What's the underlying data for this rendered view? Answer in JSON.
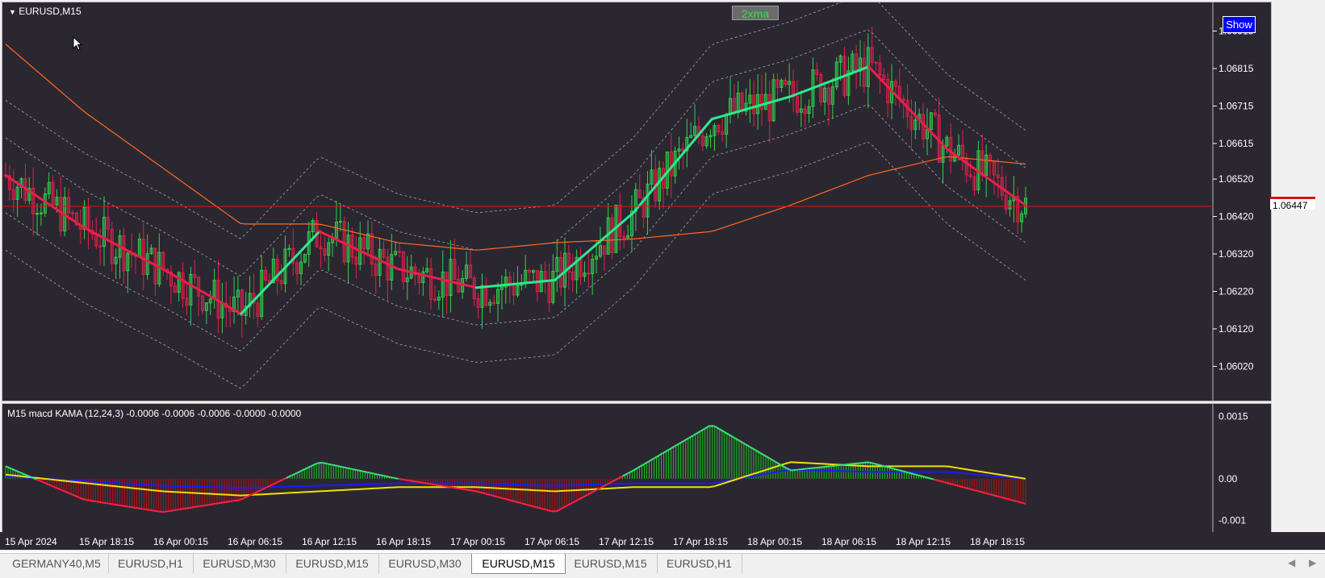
{
  "chart": {
    "symbol_title": "EURUSD,M15",
    "price_axis_labels": [
      "1.06915",
      "1.06815",
      "1.06715",
      "1.06615",
      "1.06520",
      "1.06420",
      "1.06320",
      "1.06220",
      "1.06120",
      "1.06020"
    ],
    "current_price": "1.06447",
    "buttons": {
      "xma_label": "2xma",
      "show_label": "Show"
    },
    "colors": {
      "background": "#2b2731",
      "bull_candle": "#2fd14b",
      "bear_candle": "#e0204a",
      "kama_up": "#2ee88f",
      "kama_down": "#e8204a",
      "long_ma": "#ff6a20",
      "price_line": "#e01010"
    }
  },
  "indicator": {
    "title": "M15  macd KAMA (12,24,3)  -0.0006 -0.0006 -0.0006 -0.0000 -0.0000",
    "axis_labels": [
      "0.0015",
      "0.00",
      "-0.001"
    ],
    "colors": {
      "hist_pos": "#19c21f",
      "hist_neg": "#b31111",
      "signal": "#f2e000",
      "base": "#1a1aff"
    }
  },
  "time_axis": [
    "15 Apr 2024",
    "15 Apr 18:15",
    "16 Apr 00:15",
    "16 Apr 06:15",
    "16 Apr 12:15",
    "16 Apr 18:15",
    "17 Apr 00:15",
    "17 Apr 06:15",
    "17 Apr 12:15",
    "17 Apr 18:15",
    "18 Apr 00:15",
    "18 Apr 06:15",
    "18 Apr 12:15",
    "18 Apr 18:15"
  ],
  "tabs": [
    "GERMANY40,M5",
    "EURUSD,H1",
    "EURUSD,M30",
    "EURUSD,M15",
    "EURUSD,M30",
    "EURUSD,M15",
    "EURUSD,M15",
    "EURUSD,H1"
  ],
  "active_tab_index": 5,
  "chart_data": {
    "type": "line",
    "title": "EURUSD,M15",
    "xlabel": "",
    "ylabel": "",
    "ylim": [
      1.0598,
      1.0697
    ],
    "x": [
      "15 Apr 2024",
      "15 Apr 18:15",
      "16 Apr 00:15",
      "16 Apr 06:15",
      "16 Apr 12:15",
      "16 Apr 18:15",
      "17 Apr 00:15",
      "17 Apr 06:15",
      "17 Apr 12:15",
      "17 Apr 18:15",
      "18 Apr 00:15",
      "18 Apr 06:15",
      "18 Apr 12:15",
      "18 Apr 18:15"
    ],
    "series": [
      {
        "values": [
          1.0653,
          1.0639,
          1.0628,
          1.0616,
          1.0638,
          1.0628,
          1.0623,
          1.0625,
          1.0643,
          1.0668,
          1.0674,
          1.0682,
          1.066,
          1.0645
        ]
      },
      {
        "values": [
          1.0688,
          1.067,
          1.0655,
          1.064,
          1.064,
          1.0635,
          1.0633,
          1.0635,
          1.0636,
          1.0638,
          1.0645,
          1.0653,
          1.0658,
          1.0656
        ]
      }
    ],
    "indicator_ylim": [
      -0.0012,
      0.0017
    ],
    "indicator_series": [
      {
        "values": [
          0.0003,
          -0.0005,
          -0.0008,
          -0.0005,
          0.0004,
          0.0,
          -0.0003,
          -0.0008,
          0.0002,
          0.0013,
          0.0002,
          0.0004,
          -0.0001,
          -0.0006
        ]
      },
      {
        "values": [
          0.0001,
          -0.0001,
          -0.0003,
          -0.0004,
          -0.0003,
          -0.0002,
          -0.0002,
          -0.0003,
          -0.0002,
          -0.0002,
          0.0004,
          0.0003,
          0.0003,
          0.0
        ]
      }
    ]
  }
}
